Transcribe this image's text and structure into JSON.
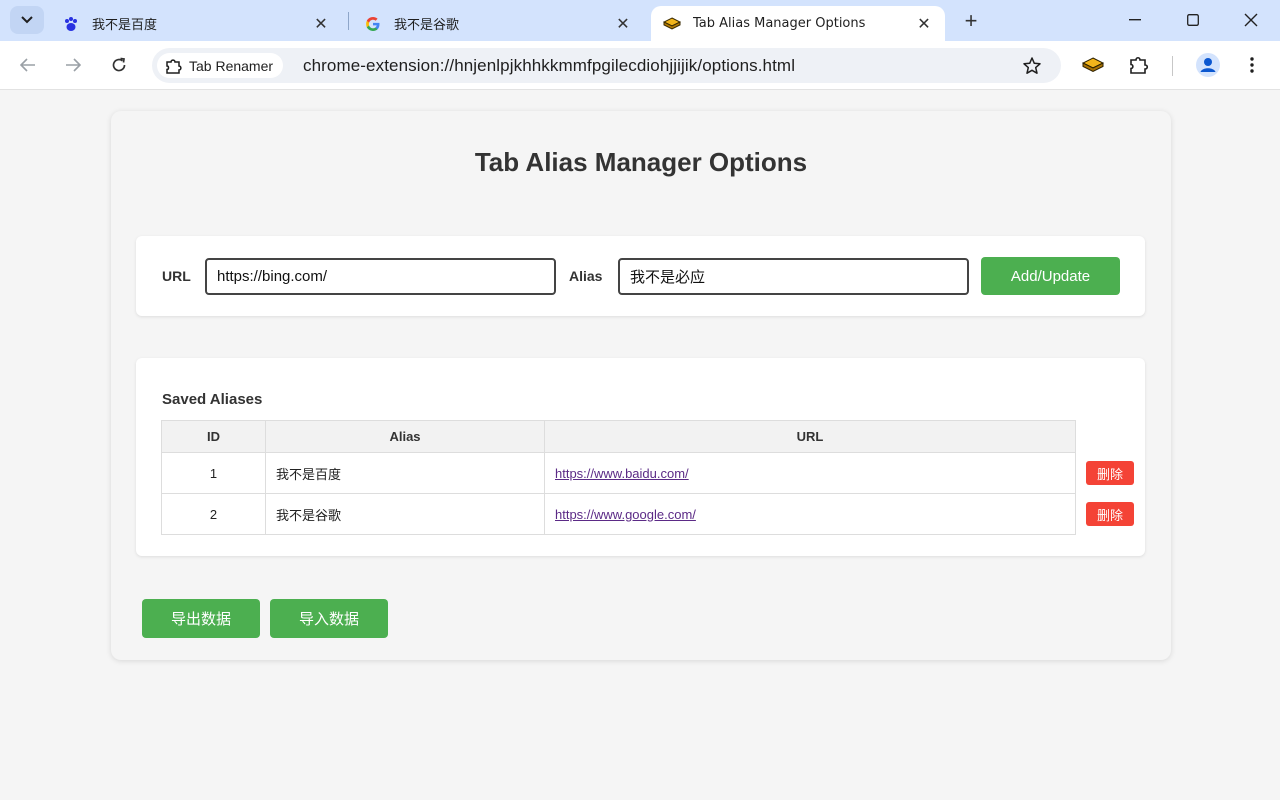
{
  "browser": {
    "tabs": [
      {
        "title": "我不是百度",
        "favicon": "baidu-paw-icon"
      },
      {
        "title": "我不是谷歌",
        "favicon": "google-g-icon"
      },
      {
        "title": "Tab Alias Manager Options",
        "favicon": "extension-brick-icon"
      }
    ],
    "omnibox": {
      "chip_label": "Tab Renamer",
      "url": "chrome-extension://hnjenlpjkhhkkmmfpgilecdiohjjijik/options.html"
    }
  },
  "page": {
    "title": "Tab Alias Manager Options",
    "form": {
      "url_label": "URL",
      "url_value": "https://bing.com/",
      "alias_label": "Alias",
      "alias_value": "我不是必应",
      "submit_label": "Add/Update"
    },
    "saved": {
      "heading": "Saved Aliases",
      "columns": [
        "ID",
        "Alias",
        "URL"
      ],
      "rows": [
        {
          "id": "1",
          "alias": "我不是百度",
          "url": "https://www.baidu.com/",
          "delete_label": "删除"
        },
        {
          "id": "2",
          "alias": "我不是谷歌",
          "url": "https://www.google.com/",
          "delete_label": "删除"
        }
      ]
    },
    "export_label": "导出数据",
    "import_label": "导入数据"
  },
  "colors": {
    "accent_green": "#4caf50",
    "delete_red": "#f44336",
    "tabstrip": "#d3e3fd"
  }
}
